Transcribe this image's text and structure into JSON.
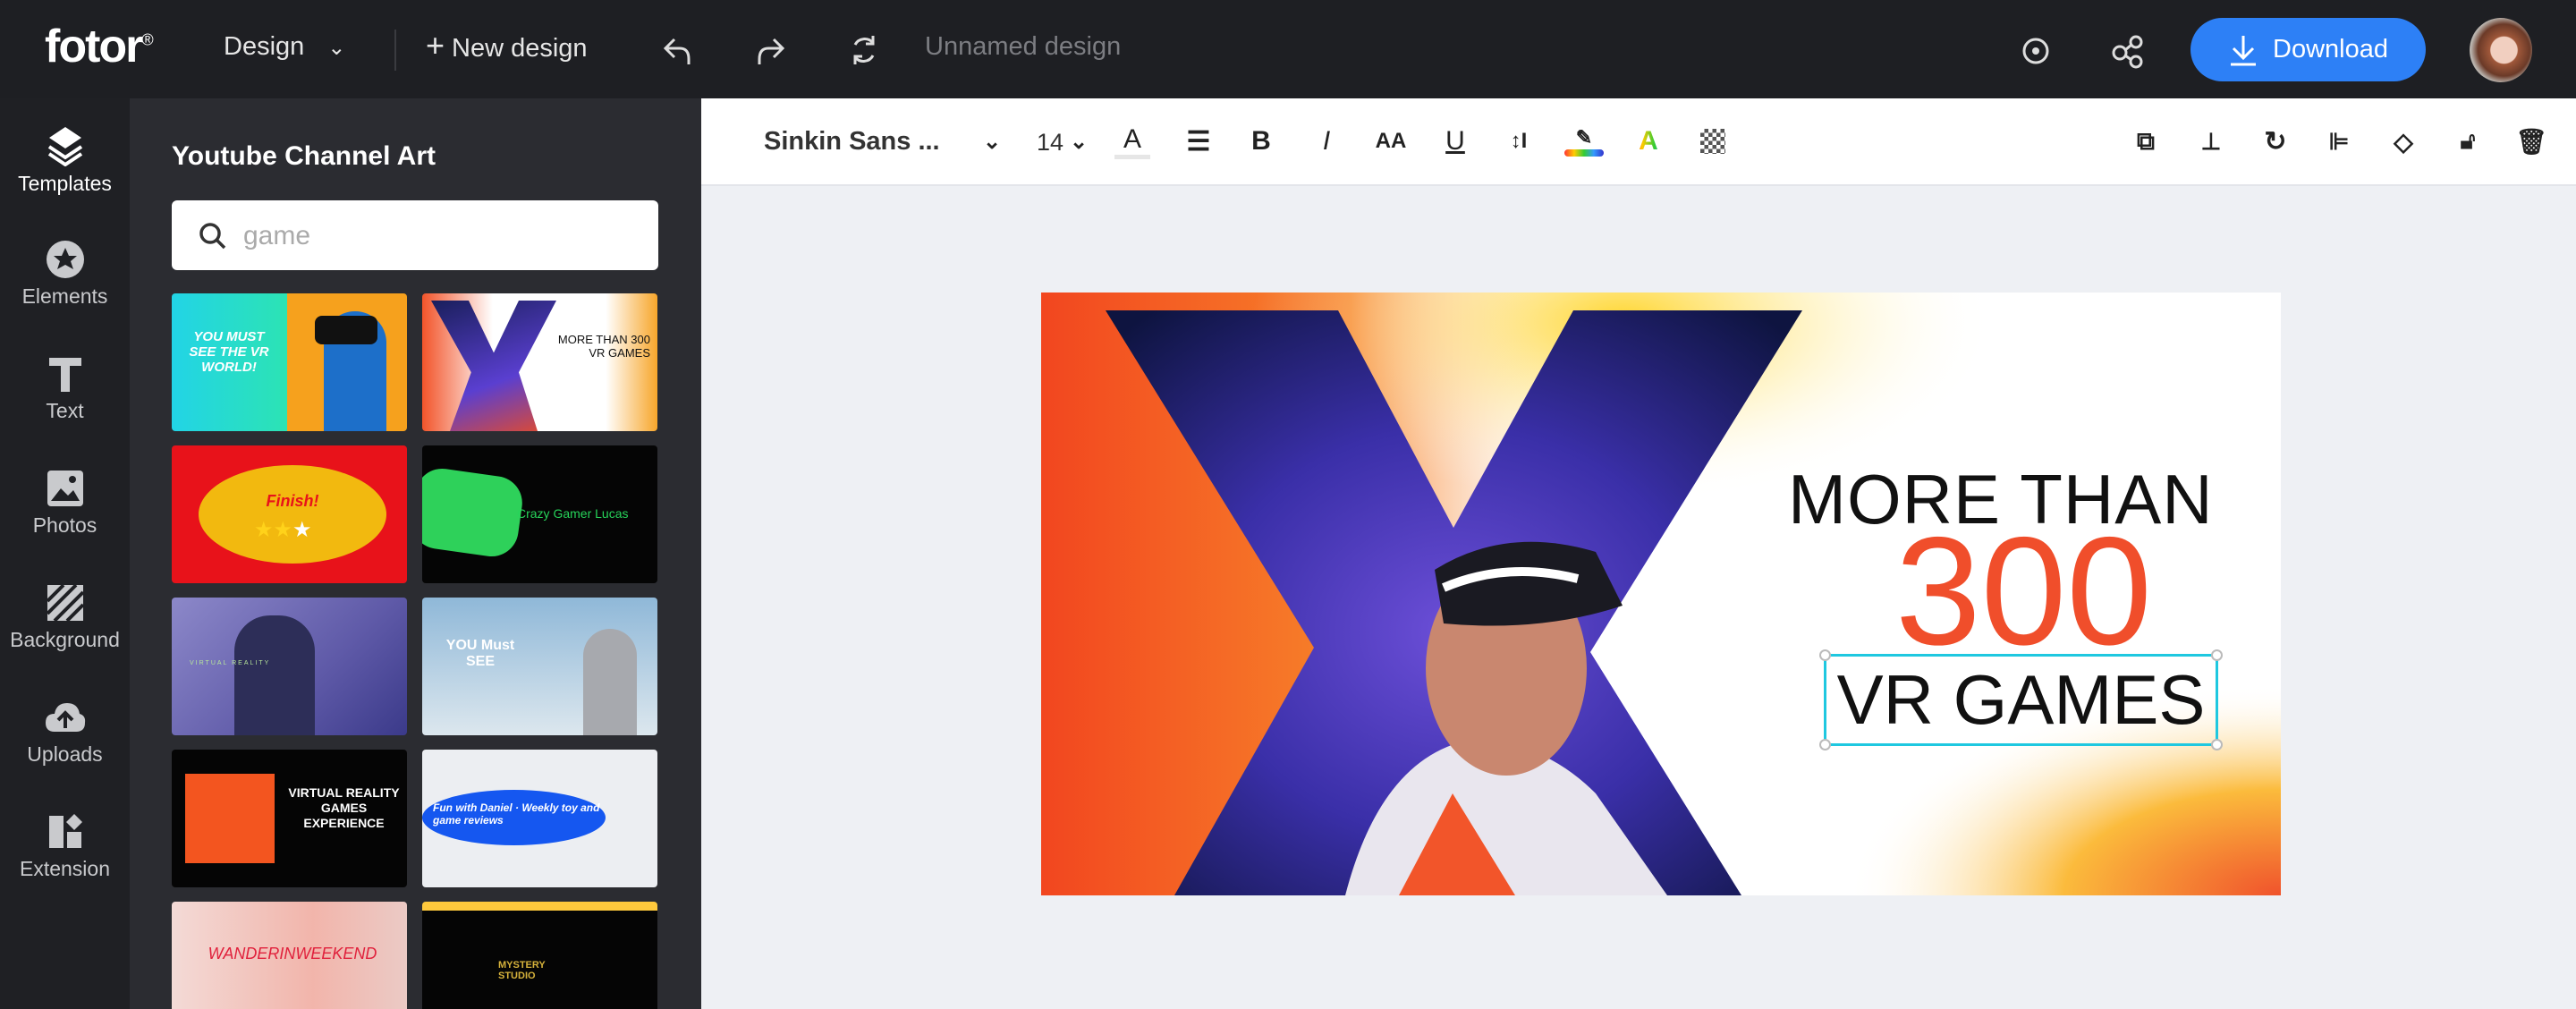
{
  "topbar": {
    "logo": "fotor",
    "logo_mark": "®",
    "design_menu": "Design",
    "new_design": "New design",
    "doc_title": "Unnamed design",
    "download": "Download",
    "brand_color": "#2d80f6"
  },
  "rail": {
    "items": [
      {
        "label": "Templates",
        "icon": "layers-icon"
      },
      {
        "label": "Elements",
        "icon": "star-icon"
      },
      {
        "label": "Text",
        "icon": "text-icon"
      },
      {
        "label": "Photos",
        "icon": "image-icon"
      },
      {
        "label": "Background",
        "icon": "background-icon"
      },
      {
        "label": "Uploads",
        "icon": "cloud-upload-icon"
      },
      {
        "label": "Extension",
        "icon": "extension-icon"
      }
    ]
  },
  "panel": {
    "title": "Youtube Channel Art",
    "search": {
      "value": "game",
      "placeholder": "game"
    },
    "templates": [
      {
        "text": "YOU MUST SEE THE VR WORLD!"
      },
      {
        "text": "MORE THAN 300 VR GAMES"
      },
      {
        "text": "Finish!"
      },
      {
        "text": "Crazy Gamer Lucas"
      },
      {
        "text": "VIRTUAL REALITY"
      },
      {
        "text": "YOU Must SEE"
      },
      {
        "text": "VIRTUAL REALITY GAMES EXPERIENCE"
      },
      {
        "text": "Fun with Daniel · Weekly toy and game reviews"
      },
      {
        "text": "WANDERINWEEKEND"
      },
      {
        "text": "MYSTERY STUDIO"
      }
    ]
  },
  "toolbar": {
    "font": "Sinkin Sans ...",
    "size": "14"
  },
  "design": {
    "line1": "MORE THAN",
    "line2": "300",
    "line3": "VR GAMES",
    "accent": "#f04e2b",
    "selection_color": "#1fc8e0"
  }
}
